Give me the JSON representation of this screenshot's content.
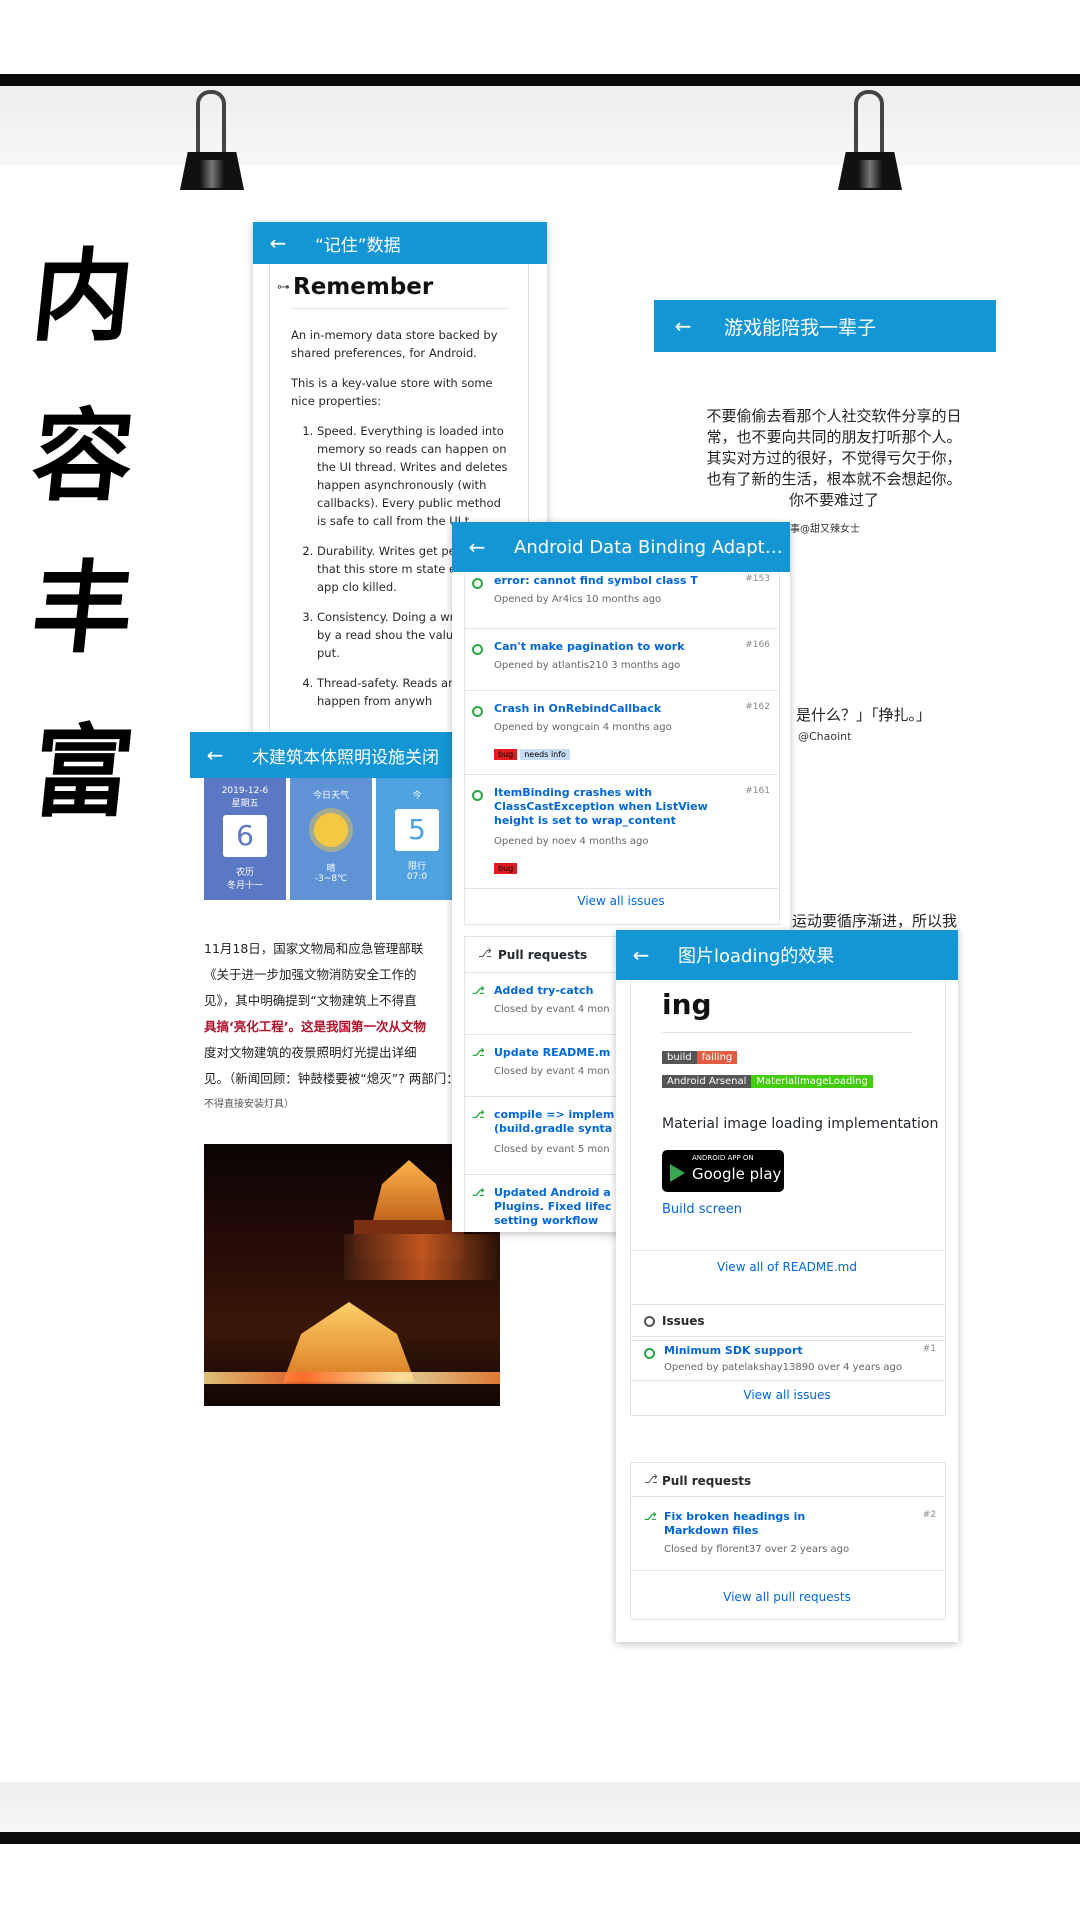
{
  "calligraphy": [
    "内",
    "容",
    "丰",
    "富"
  ],
  "remember_card": {
    "appbar_title": "“记住”数据",
    "heading": "Remember",
    "intro1": "An in-memory data store backed by shared preferences, for Android.",
    "intro2": "This is a key-value store with some nice properties:",
    "items": [
      "Speed. Everything is loaded into memory so reads can happen on the UI thread. Writes and deletes happen asynchronously (with callbacks). Every public method is safe to call from the UI t",
      "Durability. Writes get pe disk, so that this store m state even if the app clo killed.",
      "Consistency. Doing a wr followed by a read shou the value you just put.",
      "Thread-safety. Reads an can happen from anywh"
    ]
  },
  "game_card": {
    "appbar_title": "游戏能陪我一辈子",
    "paragraph_lines": [
      "不要偷偷去看那个人社交软件分享的日",
      "常，也不要向共同的朋友打听那个人。",
      "其实对方过的很好，不觉得亏欠于你，",
      "也有了新的生活，根本就不会想起你。",
      "你不要难过了"
    ],
    "attribution": "事@甜又辣女士",
    "snippet1": "是什么？」「挣扎。」",
    "snippet2": "@Chaoint",
    "snippet3": "运动要循序渐进，所以我"
  },
  "databinding_card": {
    "appbar_title": "Android Data Binding Adapt…",
    "issues": [
      {
        "title": "error: cannot find symbol class T",
        "number": "#153",
        "meta": "Opened by Ar4ics 10 months ago",
        "tags": []
      },
      {
        "title": "Can't make pagination to work",
        "number": "#166",
        "meta": "Opened by atlantis210 3 months ago",
        "tags": []
      },
      {
        "title": "Crash in OnRebindCallback",
        "number": "#162",
        "meta": "Opened by wongcain 4 months ago",
        "tags": [
          "bug",
          "needs info"
        ]
      },
      {
        "title": "ItemBinding crashes with ClassCastException when ListView height is set to wrap_content",
        "number": "#161",
        "meta": "Opened by noev 4 months ago",
        "tags": [
          "bug"
        ]
      }
    ],
    "view_all_issues": "View all issues",
    "pull_requests_label": "Pull requests",
    "pulls": [
      {
        "title": "Added try-catch",
        "meta": "Closed by evant 4 mon"
      },
      {
        "title": "Update README.m",
        "meta": "Closed by evant 4 mon"
      },
      {
        "title": "compile => implem (build.gradle synta",
        "meta": "Closed by evant 5 mon"
      },
      {
        "title": "Updated Android a Plugins. Fixed lifec setting workflow",
        "meta": ""
      }
    ]
  },
  "news_card": {
    "appbar_title": "木建筑本体照明设施关闭",
    "weather": {
      "date": "2019-12-6",
      "weekday": "星期五",
      "day_number": "6",
      "lunar_label": "农历",
      "lunar_date": "冬月十一",
      "today_label": "今日天气",
      "condition": "晴",
      "temp_range": "-3~8℃",
      "third_label": "今",
      "third_number": "5",
      "third_sub1": "限行",
      "third_sub2": "07:0"
    },
    "article_lines": [
      "11月18日，国家文物局和应急管理部联",
      "《关于进一步加强文物消防安全工作的",
      "见》，其中明确提到“文物建筑上不得直",
      "具搞‘亮化工程’。这是我国第一次从文物",
      "度对文物建筑的夜景照明灯光提出详细",
      "见。（新闻回顾：钟鼓楼要被“熄灭”? 两部门：文"
    ],
    "article_tail": "不得直接安装灯具）"
  },
  "loading_card": {
    "appbar_title": "图片loading的效果",
    "heading_frag": "ing",
    "badge_build": "build",
    "badge_failing": "failing",
    "badge_arsenal": "Android Arsenal",
    "badge_mil": "MaterialImageLoading",
    "description": "Material image loading implementation",
    "gp_top": "ANDROID APP ON",
    "gp_bottom": "Google play",
    "build_screen": "Build screen",
    "view_readme": "View all of README.md",
    "issues_label": "Issues",
    "issue": {
      "title": "Minimum SDK support",
      "number": "#1",
      "meta": "Opened by patelakshay13890 over 4 years ago"
    },
    "view_issues": "View all issues",
    "pr_label": "Pull requests",
    "pr": {
      "title": "Fix broken headings in Markdown files",
      "number": "#2",
      "meta": "Closed by florent37 over 2 years ago"
    },
    "view_prs": "View all pull requests"
  },
  "colors": {
    "appbar": "#1596d4",
    "link": "#0366d6",
    "open": "#28a745",
    "bug": "#e11d21",
    "needs_info": "#c5def5"
  }
}
